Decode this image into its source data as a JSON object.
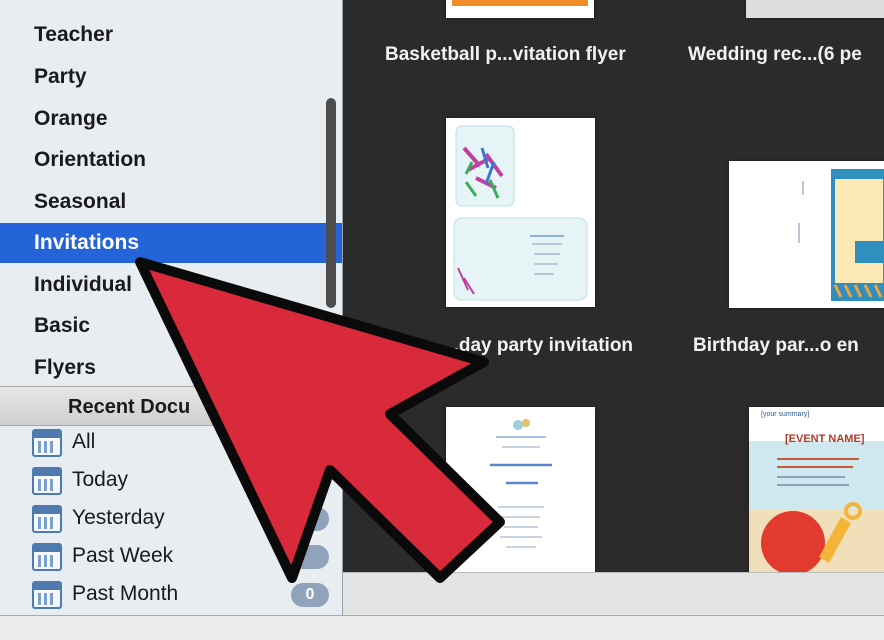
{
  "sidebar": {
    "categories": [
      {
        "label": "Teacher"
      },
      {
        "label": "Party"
      },
      {
        "label": "Orange"
      },
      {
        "label": "Orientation"
      },
      {
        "label": "Seasonal"
      },
      {
        "label": "Invitations",
        "selected": true
      },
      {
        "label": "Individual"
      },
      {
        "label": "Basic"
      },
      {
        "label": "Flyers"
      }
    ],
    "recent_header": "Recent Docu",
    "recent_items": [
      {
        "label": "All",
        "count": ""
      },
      {
        "label": "Today",
        "count": ""
      },
      {
        "label": "Yesterday",
        "count": ""
      },
      {
        "label": "Past Week",
        "count": ""
      },
      {
        "label": "Past Month",
        "count": "0"
      }
    ]
  },
  "templates": {
    "row1": [
      "Basketball p...vitation flyer",
      "Wedding rec...(6 pe"
    ],
    "row2": [
      "...day party invitation",
      "Birthday par...o en"
    ]
  },
  "thumb_text": {
    "sunrise_event": "[EVENT NAME]",
    "your_summary": "[your summary]"
  },
  "colors": {
    "selection": "#2563d9",
    "arrow": "#d92a3c",
    "content_bg": "#2b2b2b"
  }
}
